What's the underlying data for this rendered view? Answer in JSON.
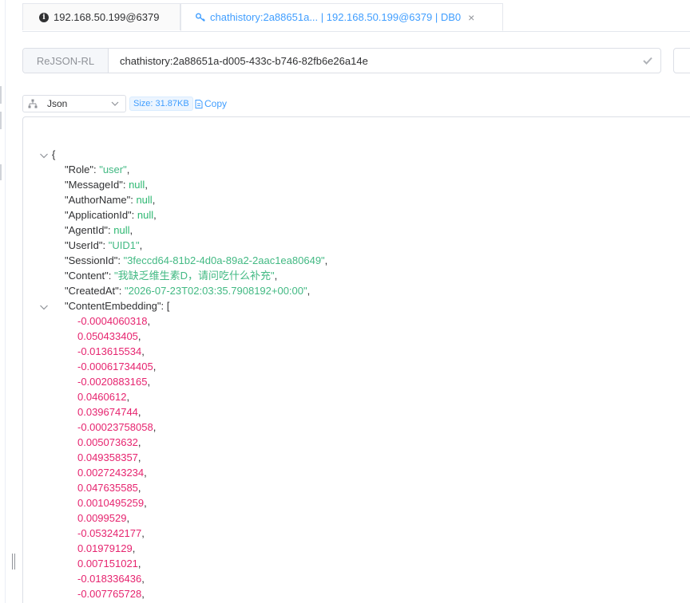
{
  "tabs": [
    {
      "label": "192.168.50.199@6379",
      "icon": "info-icon"
    },
    {
      "label": "chathistory:2a88651a... | 192.168.50.199@6379 | DB0",
      "icon": "key-icon",
      "close": "×"
    }
  ],
  "key_bar": {
    "type_label": "ReJSON-RL",
    "key_name": "chathistory:2a88651a-d005-433c-b746-82fb6e26a14e"
  },
  "toolbar": {
    "format_selected": "Json",
    "size_label": "Size: 31.87KB",
    "copy_label": "Copy"
  },
  "json": {
    "open_brace": "{",
    "fields": [
      {
        "key": "\"Role\"",
        "value": "\"user\"",
        "type": "string"
      },
      {
        "key": "\"MessageId\"",
        "value": "null",
        "type": "null"
      },
      {
        "key": "\"AuthorName\"",
        "value": "null",
        "type": "null"
      },
      {
        "key": "\"ApplicationId\"",
        "value": "null",
        "type": "null"
      },
      {
        "key": "\"AgentId\"",
        "value": "null",
        "type": "null"
      },
      {
        "key": "\"UserId\"",
        "value": "\"UID1\"",
        "type": "string"
      },
      {
        "key": "\"SessionId\"",
        "value": "\"3feccd64-81b2-4d0a-89a2-2aac1ea80649\"",
        "type": "string"
      },
      {
        "key": "\"Content\"",
        "value": "\"我缺乏维生素D，请问吃什么补充\"",
        "type": "string"
      },
      {
        "key": "\"CreatedAt\"",
        "value": "\"2026-07-23T02:03:35.7908192+00:00\"",
        "type": "string"
      }
    ],
    "array_key": "\"ContentEmbedding\"",
    "array_open": "[",
    "array_values": [
      "-0.0004060318",
      "0.050433405",
      "-0.013615534",
      "-0.00061734405",
      "-0.0020883165",
      "0.0460612",
      "0.039674744",
      "-0.00023758058",
      "0.005073632",
      "0.049358357",
      "0.0027243234",
      "0.047635585",
      "0.0010495259",
      "0.0099529",
      "-0.053242177",
      "0.01979129",
      "0.007151021",
      "-0.018336436",
      "-0.007765728"
    ]
  },
  "colors": {
    "accent": "#409eff",
    "string": "#42b983",
    "number": "#e6246f",
    "border": "#dcdfe6"
  }
}
